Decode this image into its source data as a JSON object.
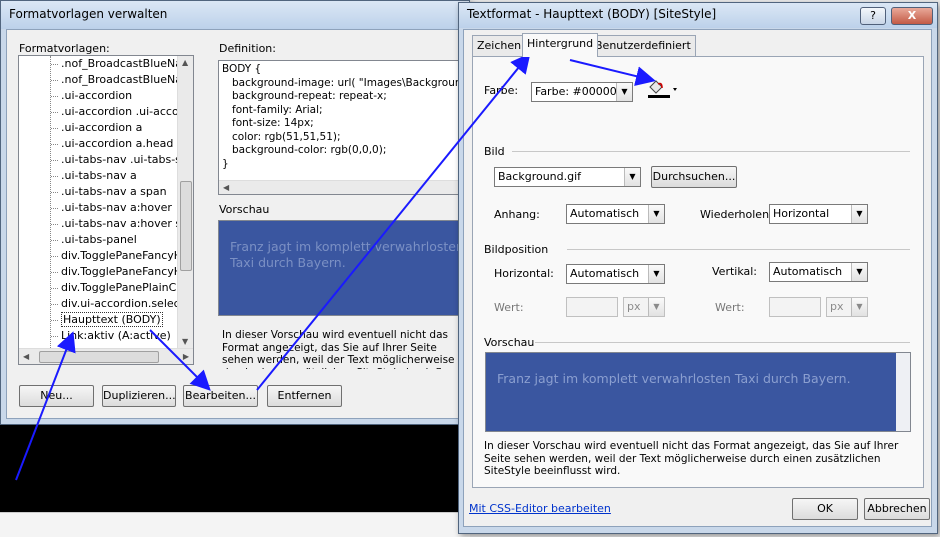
{
  "left_dialog": {
    "title": "Formatvorlagen verwalten",
    "list_label": "Formatvorlagen:",
    "items": [
      ".nof_BroadcastBlueNavb",
      ".nof_BroadcastBlueNavb",
      ".ui-accordion",
      ".ui-accordion .ui-accordio",
      ".ui-accordion a",
      ".ui-accordion a.head",
      ".ui-tabs-nav .ui-tabs-selec",
      ".ui-tabs-nav a",
      ".ui-tabs-nav a span",
      ".ui-tabs-nav a:hover",
      ".ui-tabs-nav a:hover spar",
      ".ui-tabs-panel",
      "div.TogglePaneFancyHe",
      "div.TogglePaneFancyHe",
      "div.TogglePanePlainCor",
      "div.ui-accordion.selected",
      "Haupttext (BODY)",
      "Link:aktiv (A:active)"
    ],
    "selected_item": "Haupttext (BODY)",
    "definition_label": "Definition:",
    "definition_text": "BODY {\n   background-image: url( \"Images\\Background.gif\n   background-repeat: repeat-x;\n   font-family: Arial;\n   font-size: 14px;\n   color: rgb(51,51,51);\n   background-color: rgb(0,0,0);\n}",
    "preview_label": "Vorschau",
    "preview_text": "Franz jagt im komplett verwahrlosten Taxi durch Bayern.",
    "note": "In dieser Vorschau wird eventuell nicht das Format angezeigt, das Sie auf Ihrer Seite sehen werden, weil der Text möglicherweise durch einen zusätzlichen SiteStyle beeinflusst wird.",
    "buttons": {
      "new": "Neu...",
      "duplicate": "Duplizieren...",
      "edit": "Bearbeiten...",
      "remove": "Entfernen"
    }
  },
  "right_dialog": {
    "title": "Textformat - Haupttext (BODY) [SiteStyle]",
    "help_button": "?",
    "close_button": "X",
    "tabs": [
      "Zeichen",
      "Hintergrund",
      "Benutzerdefiniert"
    ],
    "active_tab": "Hintergrund",
    "color_label": "Farbe:",
    "color_value": "Farbe: #000000",
    "image_group": "Bild",
    "image_value": "Background.gif",
    "browse_button": "Durchsuchen...",
    "attachment_label": "Anhang:",
    "attachment_value": "Automatisch",
    "repeat_label": "Wiederholen:",
    "repeat_value": "Horizontal",
    "position_group": "Bildposition",
    "horizontal_label": "Horizontal:",
    "horizontal_value": "Automatisch",
    "vertical_label": "Vertikal:",
    "vertical_value": "Automatisch",
    "value_label": "Wert:",
    "unit_value": "px",
    "preview_group": "Vorschau",
    "preview_text": "Franz jagt im komplett verwahrlosten Taxi durch Bayern.",
    "note": "In dieser Vorschau wird eventuell nicht das Format angezeigt, das Sie auf Ihrer Seite sehen werden, weil der Text möglicherweise durch einen zusätzlichen SiteStyle beeinflusst wird.",
    "css_editor_link": "Mit CSS-Editor bearbeiten",
    "ok_button": "OK",
    "cancel_button": "Abbrechen"
  },
  "colors": {
    "preview_background": "#3a56a0",
    "annotation_arrow": "#1a1aff",
    "swatch": "#000000"
  }
}
